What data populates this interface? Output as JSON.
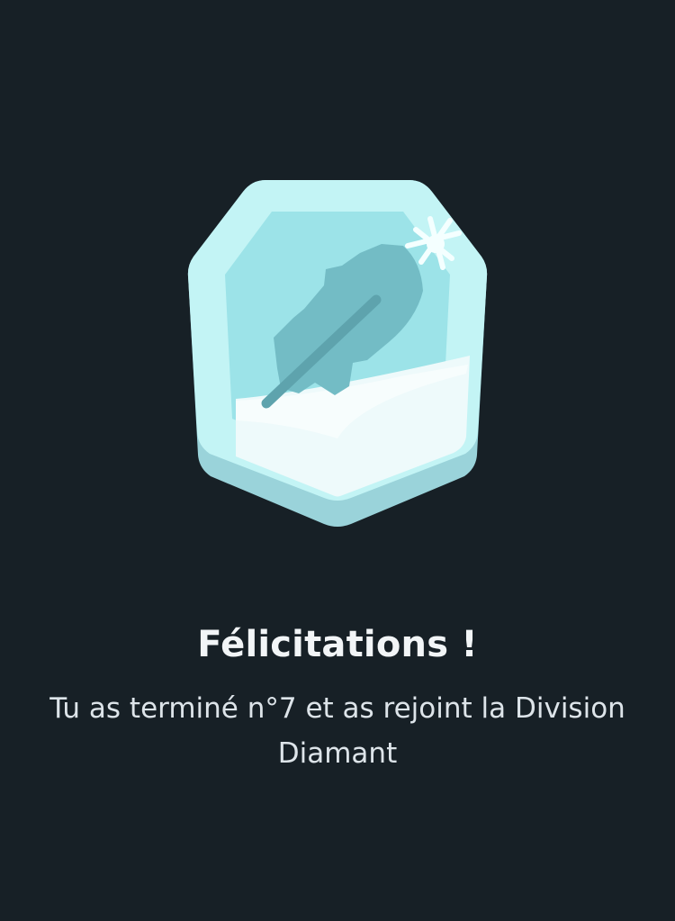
{
  "badge": {
    "icon": "feather-icon",
    "division": "Diamant",
    "colors": {
      "face": "#9ce3e8",
      "rim_light": "#c3f4f5",
      "rim_bottom": "#9ad3da",
      "shine": "#eefafb",
      "feather": "#73bcc5",
      "feather_quill": "#5ea3ad"
    }
  },
  "promotion": {
    "title": "Félicitations !",
    "message": "Tu as terminé n°7 et as rejoint la Division Diamant"
  },
  "colors": {
    "background": "#172026",
    "title_text": "#f2f5f7",
    "body_text": "#dde4e9"
  }
}
